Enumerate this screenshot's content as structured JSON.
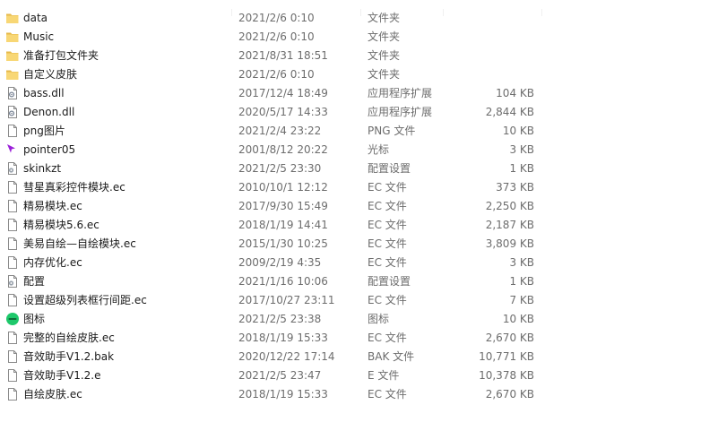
{
  "files": [
    {
      "name": "data",
      "date": "2021/2/6 0:10",
      "type": "文件夹",
      "size": "",
      "icon": "folder-icon"
    },
    {
      "name": "Music",
      "date": "2021/2/6 0:10",
      "type": "文件夹",
      "size": "",
      "icon": "folder-icon"
    },
    {
      "name": "准备打包文件夹",
      "date": "2021/8/31 18:51",
      "type": "文件夹",
      "size": "",
      "icon": "folder-icon"
    },
    {
      "name": "自定义皮肤",
      "date": "2021/2/6 0:10",
      "type": "文件夹",
      "size": "",
      "icon": "folder-icon"
    },
    {
      "name": "bass.dll",
      "date": "2017/12/4 18:49",
      "type": "应用程序扩展",
      "size": "104 KB",
      "icon": "dll-icon"
    },
    {
      "name": "Denon.dll",
      "date": "2020/5/17 14:33",
      "type": "应用程序扩展",
      "size": "2,844 KB",
      "icon": "dll-icon"
    },
    {
      "name": "png图片",
      "date": "2021/2/4 23:22",
      "type": "PNG 文件",
      "size": "10 KB",
      "icon": "file-icon"
    },
    {
      "name": "pointer05",
      "date": "2001/8/12 20:22",
      "type": "光标",
      "size": "3 KB",
      "icon": "cursor-icon"
    },
    {
      "name": "skinkzt",
      "date": "2021/2/5 23:30",
      "type": "配置设置",
      "size": "1 KB",
      "icon": "config-icon"
    },
    {
      "name": "彗星真彩控件模块.ec",
      "date": "2010/10/1 12:12",
      "type": "EC 文件",
      "size": "373 KB",
      "icon": "file-icon"
    },
    {
      "name": "精易模块.ec",
      "date": "2017/9/30 15:49",
      "type": "EC 文件",
      "size": "2,250 KB",
      "icon": "file-icon"
    },
    {
      "name": "精易模块5.6.ec",
      "date": "2018/1/19 14:41",
      "type": "EC 文件",
      "size": "2,187 KB",
      "icon": "file-icon"
    },
    {
      "name": "美易自绘—自绘模块.ec",
      "date": "2015/1/30 10:25",
      "type": "EC 文件",
      "size": "3,809 KB",
      "icon": "file-icon"
    },
    {
      "name": "内存优化.ec",
      "date": "2009/2/19 4:35",
      "type": "EC 文件",
      "size": "3 KB",
      "icon": "file-icon"
    },
    {
      "name": "配置",
      "date": "2021/1/16 10:06",
      "type": "配置设置",
      "size": "1 KB",
      "icon": "config-icon"
    },
    {
      "name": "设置超级列表框行间距.ec",
      "date": "2017/10/27 23:11",
      "type": "EC 文件",
      "size": "7 KB",
      "icon": "file-icon"
    },
    {
      "name": "图标",
      "date": "2021/2/5 23:38",
      "type": "图标",
      "size": "10 KB",
      "icon": "app-icon"
    },
    {
      "name": "完整的自绘皮肤.ec",
      "date": "2018/1/19 15:33",
      "type": "EC 文件",
      "size": "2,670 KB",
      "icon": "file-icon"
    },
    {
      "name": "音效助手V1.2.bak",
      "date": "2020/12/22 17:14",
      "type": "BAK 文件",
      "size": "10,771 KB",
      "icon": "file-icon"
    },
    {
      "name": "音效助手V1.2.e",
      "date": "2021/2/5 23:47",
      "type": "E 文件",
      "size": "10,378 KB",
      "icon": "file-icon"
    },
    {
      "name": "自绘皮肤.ec",
      "date": "2018/1/19 15:33",
      "type": "EC 文件",
      "size": "2,670 KB",
      "icon": "file-icon"
    }
  ],
  "colors": {
    "folder": "#f8d775",
    "folder_dark": "#e6b94a",
    "text_primary": "#1a1a1a",
    "text_secondary": "#6d6d6d",
    "cursor": "#9b1fd9",
    "app_icon": "#1ec86b"
  }
}
